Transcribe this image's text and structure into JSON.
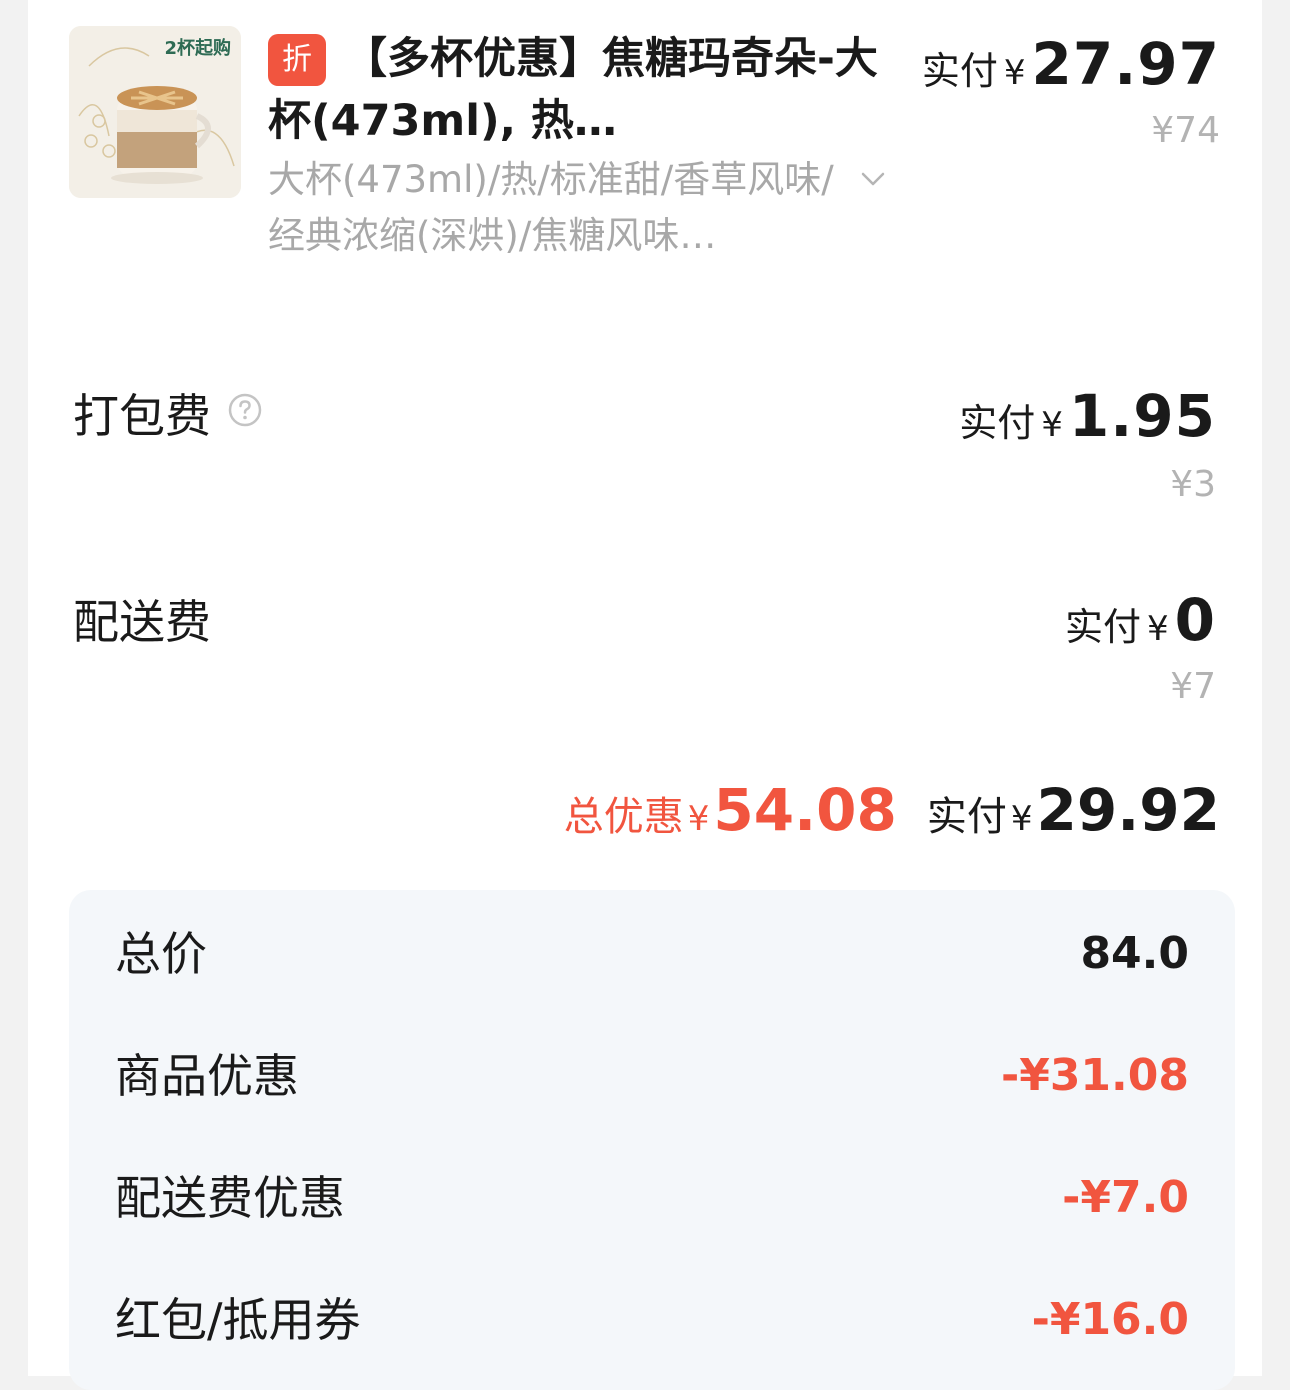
{
  "product": {
    "image_badge": "2杯起购",
    "discount_tag": "折",
    "title": "【多杯优惠】焦糖玛奇朵-大杯(473ml), 热…",
    "spec": "大杯(473ml)/热/标准甜/香草风味/经典浓缩(深烘)/焦糖风味…",
    "pay_label": "实付",
    "yen": "¥",
    "pay_amount": "27.97",
    "original_price": "¥74"
  },
  "packing_fee": {
    "label": "打包费",
    "pay_label": "实付",
    "yen": "¥",
    "pay_amount": "1.95",
    "original_price": "¥3"
  },
  "delivery_fee": {
    "label": "配送费",
    "pay_label": "实付",
    "yen": "¥",
    "pay_amount": "0",
    "original_price": "¥7"
  },
  "summary": {
    "discount_label": "总优惠",
    "discount_yen": "¥",
    "discount_amount": "54.08",
    "total_label": "实付",
    "total_yen": "¥",
    "total_amount": "29.92"
  },
  "breakdown": [
    {
      "label": "总价",
      "value": "84.0"
    },
    {
      "label": "商品优惠",
      "value": "-¥31.08"
    },
    {
      "label": "配送费优惠",
      "value": "-¥7.0"
    },
    {
      "label": "红包/抵用券",
      "value": "-¥16.0"
    }
  ],
  "colors": {
    "accent_red": "#f1553f",
    "muted_gray": "#a8a8a8",
    "breakdown_bg": "#f4f7fa"
  }
}
